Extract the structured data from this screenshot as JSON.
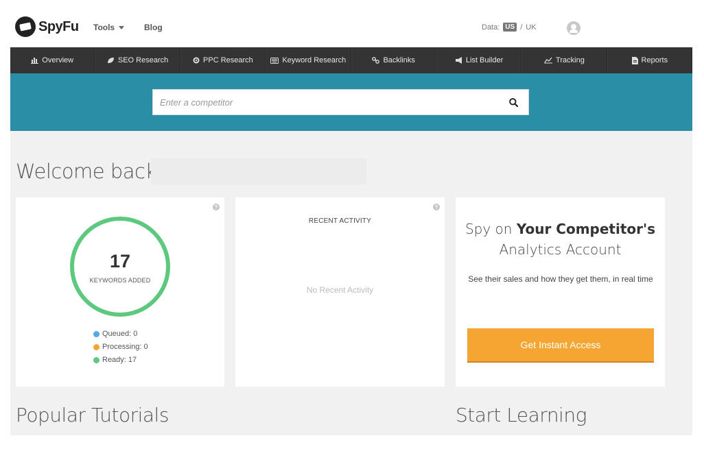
{
  "header": {
    "logo_text": "SpyFu",
    "tools_label": "Tools",
    "blog_label": "Blog",
    "data_label": "Data:",
    "data_us": "US",
    "data_sep": "/",
    "data_uk": "UK"
  },
  "nav": {
    "items": [
      {
        "label": "Overview",
        "icon": "bar-chart-icon"
      },
      {
        "label": "SEO Research",
        "icon": "leaf-icon"
      },
      {
        "label": "PPC Research",
        "icon": "target-icon"
      },
      {
        "label": "Keyword Research",
        "icon": "keyboard-icon"
      },
      {
        "label": "Backlinks",
        "icon": "link-icon"
      },
      {
        "label": "List Builder",
        "icon": "megaphone-icon"
      },
      {
        "label": "Tracking",
        "icon": "line-chart-icon"
      },
      {
        "label": "Reports",
        "icon": "document-icon"
      }
    ]
  },
  "search": {
    "placeholder": "Enter a competitor"
  },
  "welcome": {
    "text": "Welcome back,"
  },
  "keywords_card": {
    "count": "17",
    "label": "KEYWORDS ADDED",
    "legend": [
      {
        "label": "Queued: 0",
        "color": "#5aa8e0"
      },
      {
        "label": "Processing: 0",
        "color": "#f5a632"
      },
      {
        "label": "Ready: 17",
        "color": "#5cc97f"
      }
    ],
    "ring_color": "#5cc97f"
  },
  "recent_card": {
    "title": "RECENT ACTIVITY",
    "empty": "No Recent Activity"
  },
  "promo_card": {
    "heading_pre": "Spy on ",
    "heading_bold": "Your Competitor's",
    "heading_line2": "Analytics Account",
    "body": "See their sales and how they get them, in real time",
    "cta": "Get Instant Access",
    "cta_color": "#f5a632"
  },
  "sections": {
    "popular": "Popular Tutorials",
    "learning": "Start Learning"
  },
  "colors": {
    "nav_bg": "#343434",
    "band_bg": "#2a8fa6",
    "content_bg": "#f1f1f1"
  }
}
